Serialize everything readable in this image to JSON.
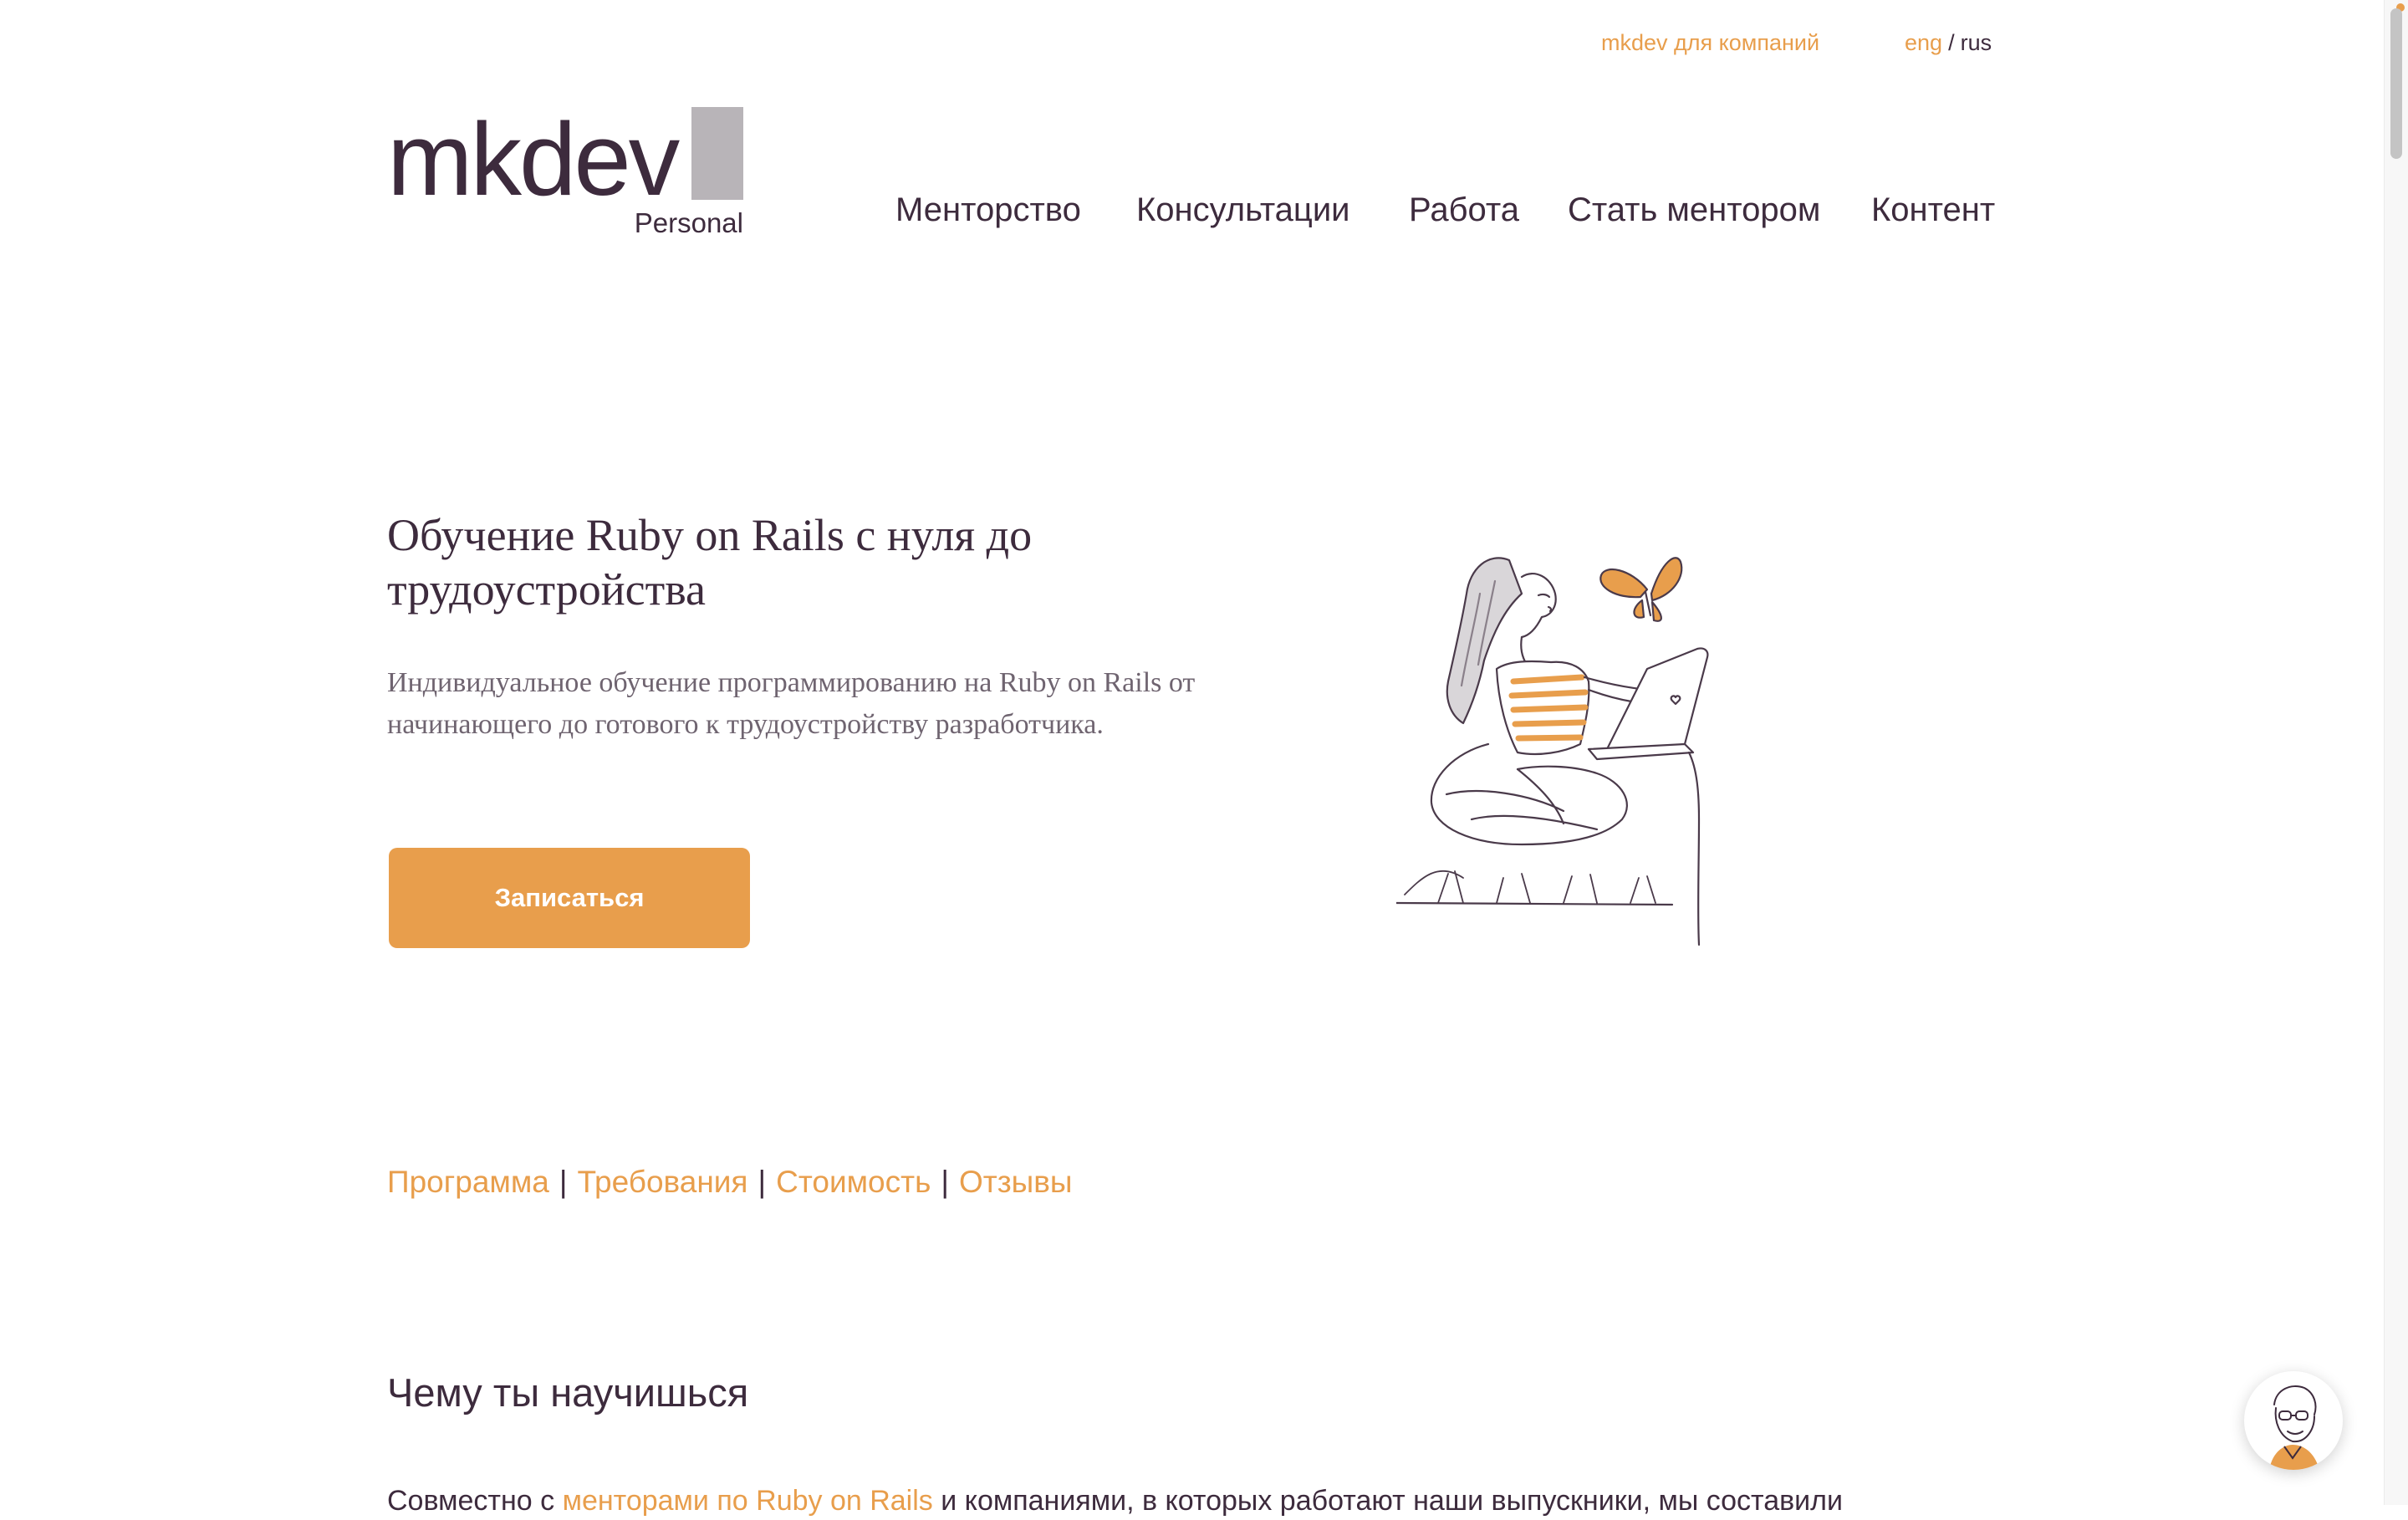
{
  "topbar": {
    "company_link": "mkdev для компаний",
    "lang_eng": "eng",
    "lang_sep": "/",
    "lang_rus": "rus"
  },
  "logo": {
    "text": "mkdev",
    "sub": "Personal"
  },
  "nav": {
    "items": [
      {
        "label": "Менторство"
      },
      {
        "label": "Консультации"
      },
      {
        "label": "Работа"
      },
      {
        "label": "Стать ментором"
      },
      {
        "label": "Контент"
      }
    ]
  },
  "hero": {
    "title": "Обучение Ruby on Rails с нуля до трудоустройства",
    "description": "Индивидуальное обучение программированию на Ruby on Rails от начинающего до готового к трудоустройству разработчика.",
    "cta_label": "Записаться"
  },
  "anchors": {
    "items": [
      "Программа",
      "Требования",
      "Стоимость",
      "Отзывы"
    ],
    "separator": "|"
  },
  "learn": {
    "title": "Чему ты научишься",
    "text_before": "Совместно с ",
    "text_link": "менторами по Ruby on Rails",
    "text_after": " и компаниями, в которых работают наши выпускники, мы составили"
  },
  "colors": {
    "accent": "#e89e4c",
    "text": "#3d2b3d",
    "muted": "#6f6470",
    "logo_block": "#b8b4b8"
  },
  "icons": {
    "illustration": "girl-with-laptop-and-butterfly-illustration",
    "chat": "mentor-avatar-icon"
  }
}
